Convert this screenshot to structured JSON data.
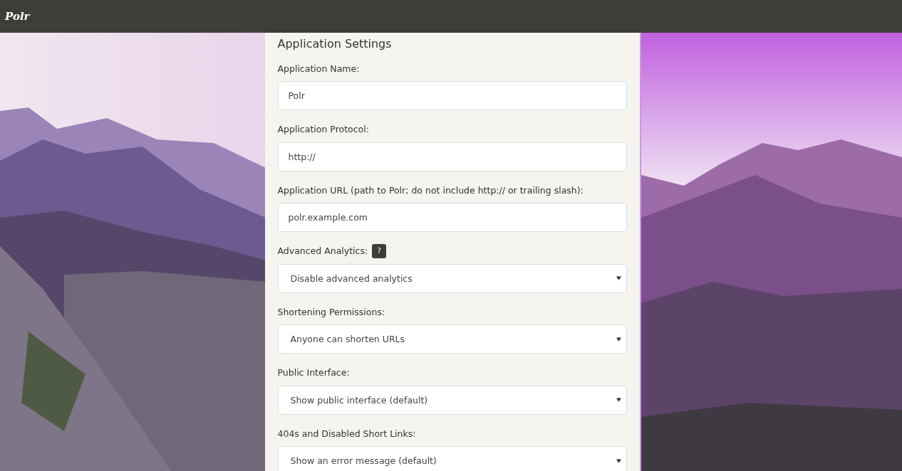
{
  "navbar": {
    "brand": "Polr"
  },
  "settings": {
    "title": "Application Settings",
    "fields": [
      {
        "kind": "text",
        "label": "Application Name:",
        "value": "Polr"
      },
      {
        "kind": "text",
        "label": "Application Protocol:",
        "value": "http://"
      },
      {
        "kind": "text",
        "label": "Application URL (path to Polr; do not include http:// or trailing slash):",
        "value": "polr.example.com"
      },
      {
        "kind": "select",
        "label": "Advanced Analytics:",
        "help": "?",
        "value": "Disable advanced analytics"
      },
      {
        "kind": "select",
        "label": "Shortening Permissions:",
        "value": "Anyone can shorten URLs"
      },
      {
        "kind": "select",
        "label": "Public Interface:",
        "value": "Show public interface (default)"
      },
      {
        "kind": "select",
        "label": "404s and Disabled Short Links:",
        "value": "Show an error message (default)"
      }
    ]
  }
}
